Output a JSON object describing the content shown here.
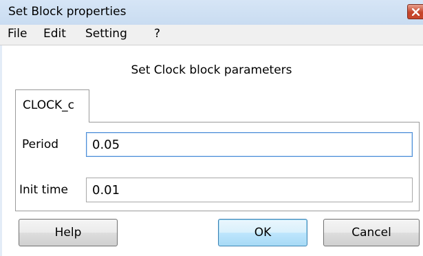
{
  "window": {
    "title": "Set Block properties",
    "close_icon": "close-icon"
  },
  "menu": {
    "items": [
      "File",
      "Edit",
      "Setting",
      "?"
    ]
  },
  "header": {
    "text": "Set Clock block parameters"
  },
  "tabs": [
    {
      "label": "CLOCK_c",
      "selected": true
    }
  ],
  "fields": [
    {
      "label": "Period",
      "value": "0.05",
      "focused": true
    },
    {
      "label": "Init time",
      "value": "0.01",
      "focused": false
    }
  ],
  "buttons": {
    "help": "Help",
    "ok": "OK",
    "cancel": "Cancel",
    "default": "ok"
  },
  "colors": {
    "titlebar": "#c9dcf1",
    "close_button": "#c4432a",
    "focus_border": "#4f8fd8",
    "default_button": "#bee6fd"
  }
}
